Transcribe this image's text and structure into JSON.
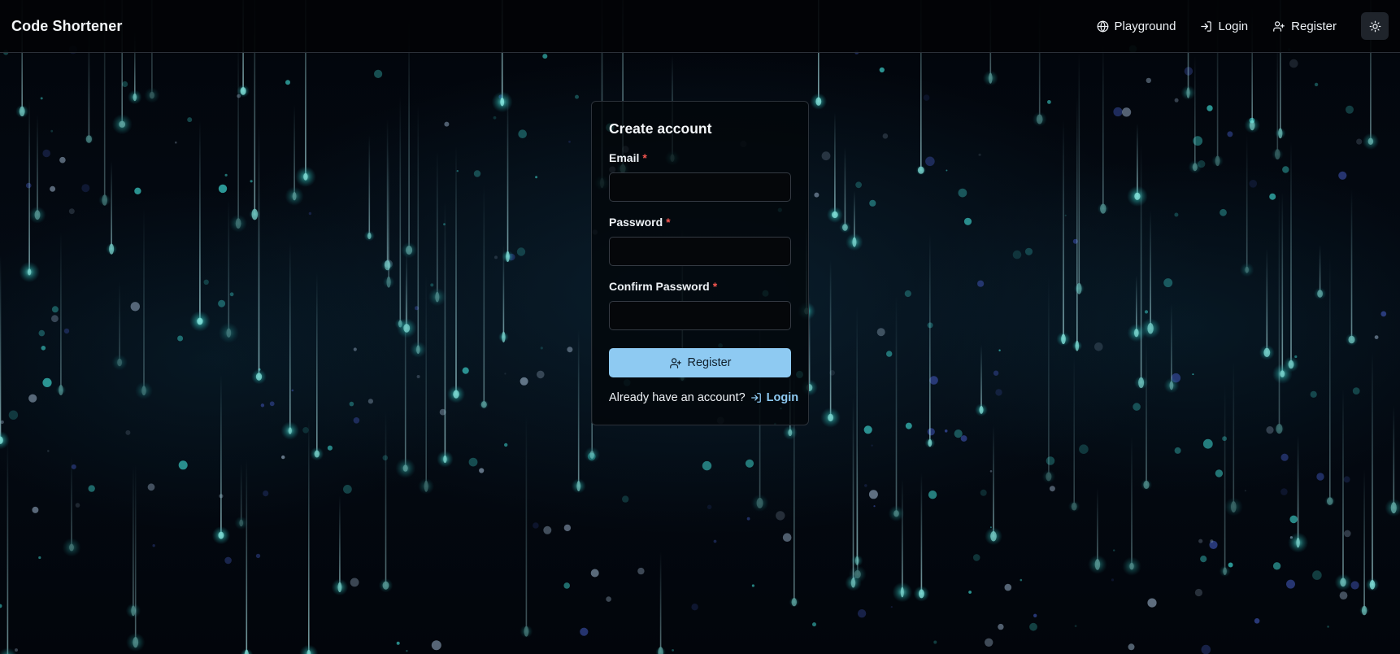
{
  "navbar": {
    "brand": "Code Shortener",
    "links": [
      {
        "label": "Playground",
        "icon": "globe-icon"
      },
      {
        "label": "Login",
        "icon": "login-icon"
      },
      {
        "label": "Register",
        "icon": "user-plus-icon"
      }
    ],
    "theme_toggle_icon": "sun-icon"
  },
  "form": {
    "title": "Create account",
    "fields": [
      {
        "label": "Email",
        "required_mark": "*",
        "value": ""
      },
      {
        "label": "Password",
        "required_mark": "*",
        "value": ""
      },
      {
        "label": "Confirm Password",
        "required_mark": "*",
        "value": ""
      }
    ],
    "submit_label": "Register",
    "submit_icon": "user-plus-icon",
    "footer_text": "Already have an account?",
    "footer_link_label": "Login",
    "footer_link_icon": "login-icon"
  },
  "colors": {
    "accent": "#8ecaf2",
    "required": "#f2554f",
    "background": "#02060d",
    "particle": "#3fd6d0"
  }
}
